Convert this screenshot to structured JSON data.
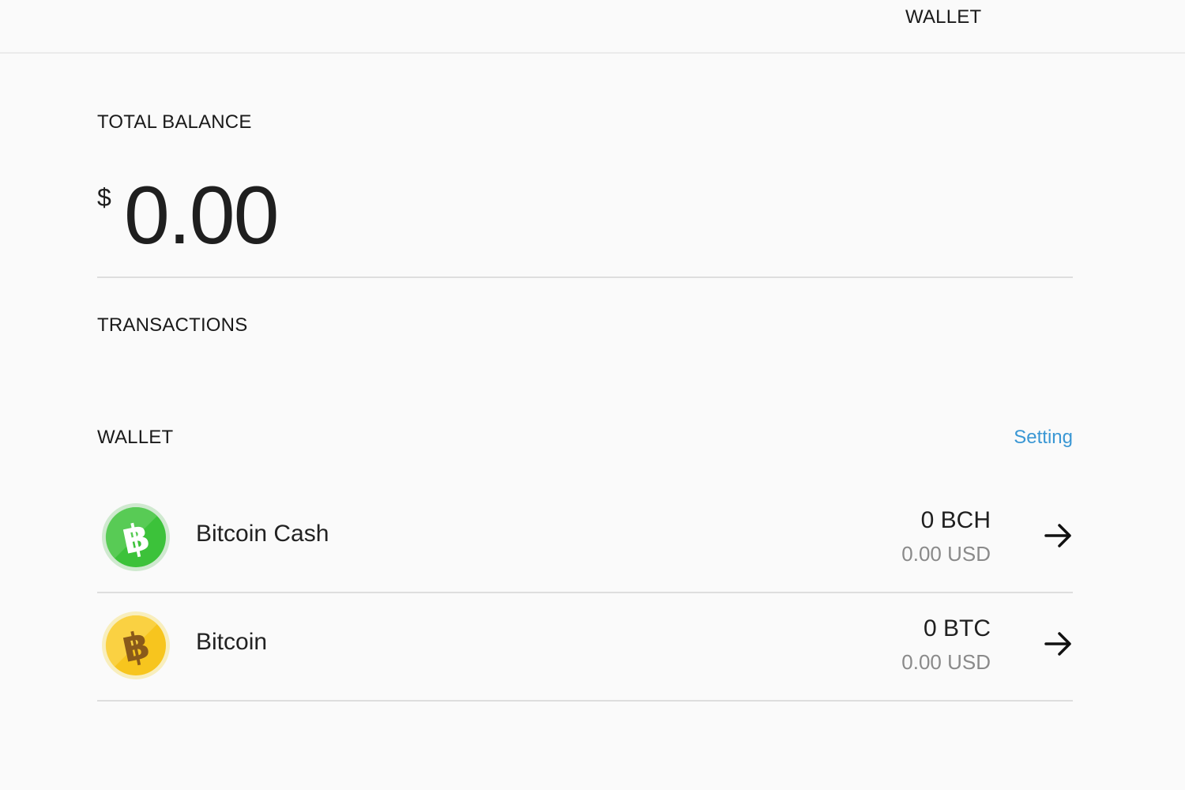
{
  "header": {
    "title": "WALLET"
  },
  "balance": {
    "label": "TOTAL BALANCE",
    "currency_symbol": "$",
    "amount": "0.00"
  },
  "transactions": {
    "label": "TRANSACTIONS"
  },
  "wallet": {
    "label": "WALLET",
    "setting_label": "Setting",
    "items": [
      {
        "name": "Bitcoin Cash",
        "amount": "0 BCH",
        "usd": "0.00 USD",
        "icon": "bitcoin-cash-icon",
        "color": "#3cc23a"
      },
      {
        "name": "Bitcoin",
        "amount": "0 BTC",
        "usd": "0.00 USD",
        "icon": "bitcoin-icon",
        "color": "#f7c51e"
      }
    ]
  },
  "colors": {
    "accent_link": "#3a97d4",
    "background": "#fafafa",
    "divider": "#dedede"
  }
}
